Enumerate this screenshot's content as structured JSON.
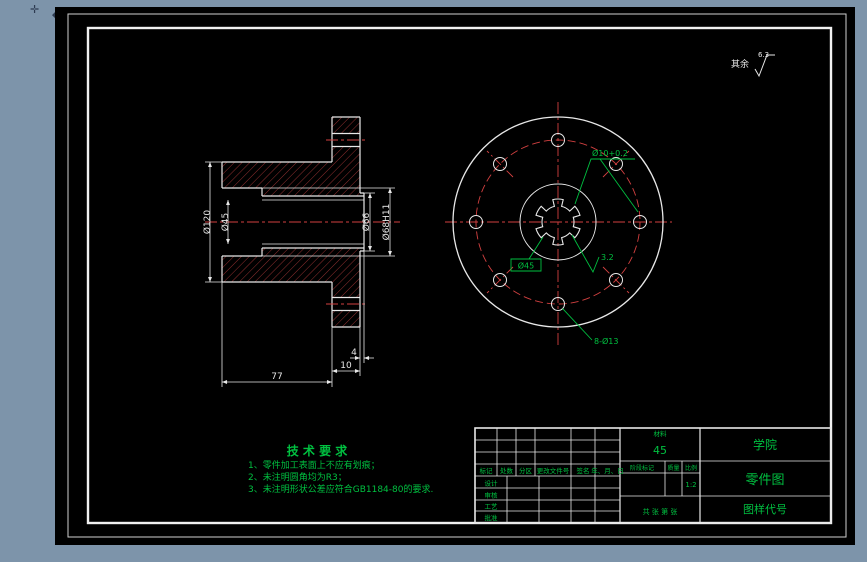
{
  "chrome": {
    "marks": [
      {
        "name": "cross-mark",
        "glyph": "✛"
      },
      {
        "name": "diamond-mark",
        "glyph": "◆"
      }
    ]
  },
  "drawing": {
    "surface_note": {
      "prefix": "其余",
      "value": "6.3"
    },
    "left_view": {
      "dims": {
        "outer_dia": "Ø120",
        "bore_dia": "Ø45",
        "spigot_dia": "Ø66",
        "counterbore_dia": "Ø68H11",
        "hub_length": "77",
        "flange_thickness": "10",
        "spigot_length": "4"
      }
    },
    "right_view": {
      "annotations": {
        "spline_width": "Ø10+0.2",
        "bore_boxed": "Ø45",
        "roughness": "3.2",
        "bolt_holes": "8-Ø13"
      }
    },
    "tech_requirements": {
      "title": "技 术 要 求",
      "items": [
        "1、零件加工表面上不应有划痕；",
        "2、未注明圆角均为R3；",
        "3、未注明形状公差应符合GB1184-80的要求."
      ]
    },
    "title_block": {
      "school": "学院",
      "doc_type": "零件图",
      "drawing_no_label": "图样代号",
      "material_label": "材料",
      "material_value": "45",
      "stage_label": "阶段标记",
      "qty_label": "质量",
      "scale_label": "比例",
      "scale_value": "1:2",
      "sheet_text": "共 张 第 张",
      "rev_headers": [
        "标记",
        "处数",
        "分区",
        "更改文件号",
        "签名",
        "年、月、日"
      ],
      "sign_rows": [
        "设计",
        "审核",
        "工艺",
        "批准"
      ]
    }
  }
}
